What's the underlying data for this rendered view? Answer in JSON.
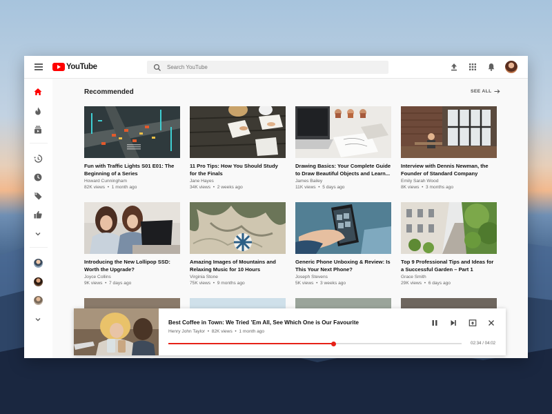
{
  "app": {
    "logo_text": "YouTube"
  },
  "search": {
    "placeholder": "Search YouTube"
  },
  "topbar_icons": [
    "upload-icon",
    "apps-grid-icon",
    "bell-icon",
    "account-avatar"
  ],
  "sidebar": {
    "icons": [
      "home-icon",
      "trending-icon",
      "subscriptions-icon",
      "history-icon",
      "watch-later-icon",
      "tag-icon",
      "thumbs-up-icon",
      "chevron-down-icon"
    ],
    "active": "home-icon",
    "subscriptions": [
      "channel-avatar-1",
      "channel-avatar-2",
      "channel-avatar-3"
    ]
  },
  "colors": {
    "accent": "#ff0000",
    "progress": "#e62117"
  },
  "recommended": {
    "title": "Recommended",
    "see_all": "SEE ALL",
    "videos": [
      {
        "title": "Fun with Traffic Lights S01 E01: The Beginning of a Series",
        "author": "Howard Cunningham",
        "views": "82K views",
        "age": "1 month ago"
      },
      {
        "title": "11 Pro Tips: How You Should Study for the Finals",
        "author": "Jane Hayes",
        "views": "34K views",
        "age": "2 weeks ago"
      },
      {
        "title": "Drawing Basics: Your Complete Guide to Draw Beautiful Objects and Learn...",
        "author": "James Bailey",
        "views": "11K views",
        "age": "5 days ago"
      },
      {
        "title": "Interview with Dennis Newman, the Founder of Standard Company",
        "author": "Emily Sarah Wood",
        "views": "8K views",
        "age": "3 months ago"
      },
      {
        "title": "Introducing the New Lollipop SSD: Worth the Upgrade?",
        "author": "Joyce Collins",
        "views": "9K views",
        "age": "7 days ago"
      },
      {
        "title": "Amazing Images of Mountains and Relaxing Music for 10 Hours",
        "author": "Virginia Stone",
        "views": "75K views",
        "age": "9 months ago"
      },
      {
        "title": "Generic Phone Unboxing & Review: Is This Your Next Phone?",
        "author": "Joseph Stevens",
        "views": "5K views",
        "age": "3 weeks ago"
      },
      {
        "title": "Top 9 Professional Tips and Ideas for a Successful Garden – Part 1",
        "author": "Grace Smith",
        "views": "29K views",
        "age": "6 days ago"
      }
    ]
  },
  "miniplayer": {
    "title": "Best Coffee in Town: We Tried ’Em All, See Which One is Our Favourite",
    "author": "Henry John Taylor",
    "views": "82K views",
    "age": "1 month ago",
    "time": "02:34 / 04:02",
    "progress": 0.564
  },
  "meta_separator": "•"
}
